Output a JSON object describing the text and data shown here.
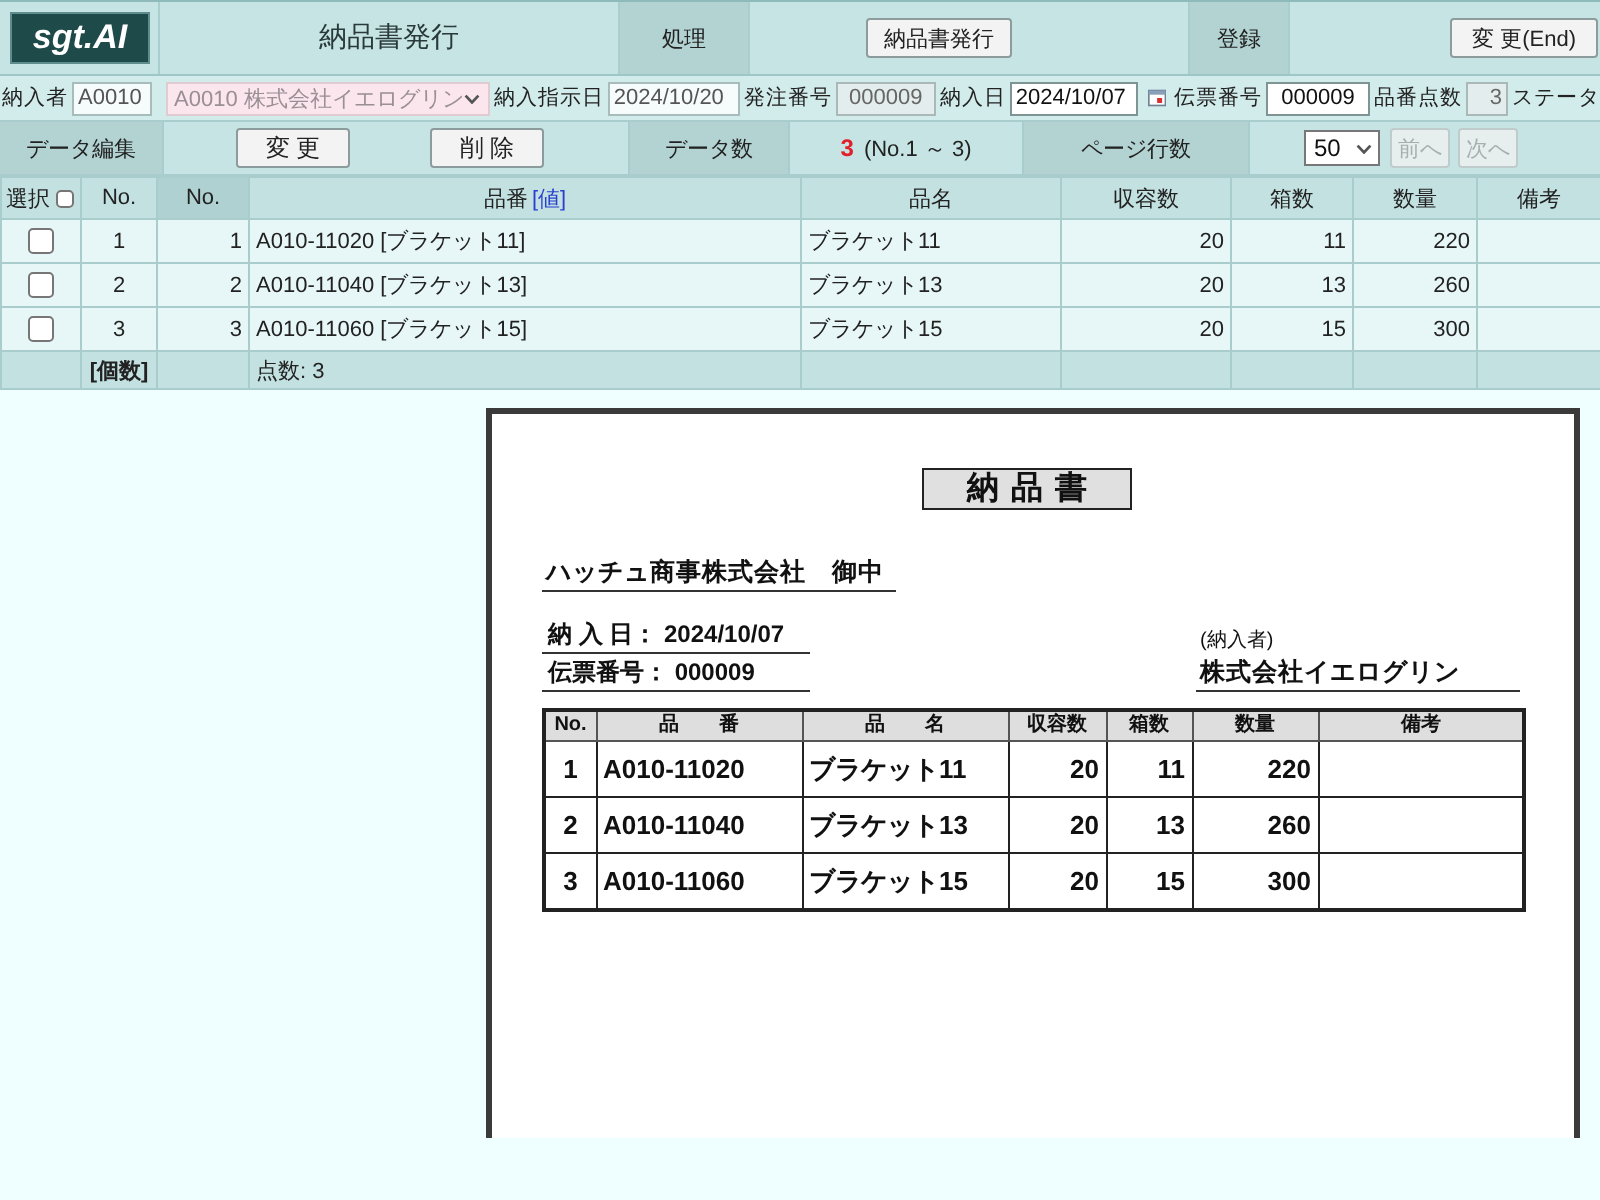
{
  "header": {
    "logo": "sgt.AI",
    "title": "納品書発行",
    "sections": [
      {
        "label": "処理",
        "button": "納品書発行"
      },
      {
        "label": "登録",
        "button": "変 更(End)"
      }
    ]
  },
  "form": {
    "fields": [
      {
        "kind": "input",
        "label": "納入者",
        "value": "A0010",
        "readonly": true,
        "disabled": false
      },
      {
        "kind": "select",
        "value": "A0010 株式会社イエログリン",
        "disabled": true
      },
      {
        "kind": "input",
        "label": "納入指示日",
        "value": "2024/10/20",
        "readonly": true,
        "disabled": false
      },
      {
        "kind": "input",
        "label": "発注番号",
        "value": "000009",
        "readonly": false,
        "disabled": true
      },
      {
        "kind": "date",
        "label": "納入日",
        "value": "2024/10/07",
        "readonly": false,
        "disabled": false
      },
      {
        "kind": "input",
        "label": "伝票番号",
        "value": "000009",
        "readonly": false,
        "disabled": false
      },
      {
        "kind": "input",
        "label": "品番点数",
        "value": "3",
        "readonly": false,
        "disabled": true
      },
      {
        "kind": "label",
        "label": "ステータ"
      }
    ]
  },
  "toolbar": {
    "edit_label": "データ編集",
    "buttons": [
      "変 更",
      "削 除"
    ],
    "count_label": "データ数",
    "count": "3",
    "range": "(No.1 ～ 3)",
    "page_rows_label": "ページ行数",
    "page_rows": "50",
    "nav": [
      {
        "label": "前へ",
        "disabled": true
      },
      {
        "label": "次へ",
        "disabled": true
      }
    ]
  },
  "table": {
    "columns": [
      {
        "kind": "checkbox",
        "label": "選択",
        "checked": false,
        "highlighted": false
      },
      {
        "kind": "text",
        "label": "No.",
        "highlighted": false
      },
      {
        "kind": "text",
        "label": "No.",
        "highlighted": true
      },
      {
        "kind": "link",
        "label": "品番",
        "link": "[値]",
        "highlighted": false
      },
      {
        "kind": "text",
        "label": "品名",
        "highlighted": false
      },
      {
        "kind": "text",
        "label": "収容数",
        "highlighted": false
      },
      {
        "kind": "text",
        "label": "箱数",
        "highlighted": false
      },
      {
        "kind": "text",
        "label": "数量",
        "highlighted": false
      },
      {
        "kind": "text",
        "label": "備考",
        "highlighted": false
      }
    ],
    "rows": [
      {
        "checked": false,
        "cells": [
          "",
          "1",
          "1",
          "A010-11020 [ブラケット11]",
          "ブラケット11",
          "20",
          "11",
          "220"
        ]
      },
      {
        "checked": false,
        "cells": [
          "",
          "2",
          "2",
          "A010-11040 [ブラケット13]",
          "ブラケット13",
          "20",
          "13",
          "260"
        ]
      },
      {
        "checked": false,
        "cells": [
          "",
          "3",
          "3",
          "A010-11060 [ブラケット15]",
          "ブラケット15",
          "20",
          "15",
          "300"
        ]
      }
    ],
    "footer": {
      "column_2": "[個数]",
      "column_4": "点数: 3"
    }
  },
  "document": {
    "title": "納品書",
    "recipient": "ハッチュ商事株式会社　御中",
    "delivery_date": "納 入 日：  2024/10/07",
    "slip_number": "伝票番号： 000009",
    "supplier_caption": "(納入者)",
    "supplier": "株式会社イエログリン",
    "columns": [
      "No.",
      "品　　番",
      "品　　名",
      "収容数",
      "箱数",
      "数量",
      "備考"
    ],
    "rows": [
      [
        "1",
        "A010-11020",
        "ブラケット11",
        "20",
        "11",
        "220"
      ],
      [
        "2",
        "A010-11040",
        "ブラケット13",
        "20",
        "13",
        "260"
      ],
      [
        "3",
        "A010-11060",
        "ブラケット15",
        "20",
        "15",
        "300"
      ]
    ]
  }
}
